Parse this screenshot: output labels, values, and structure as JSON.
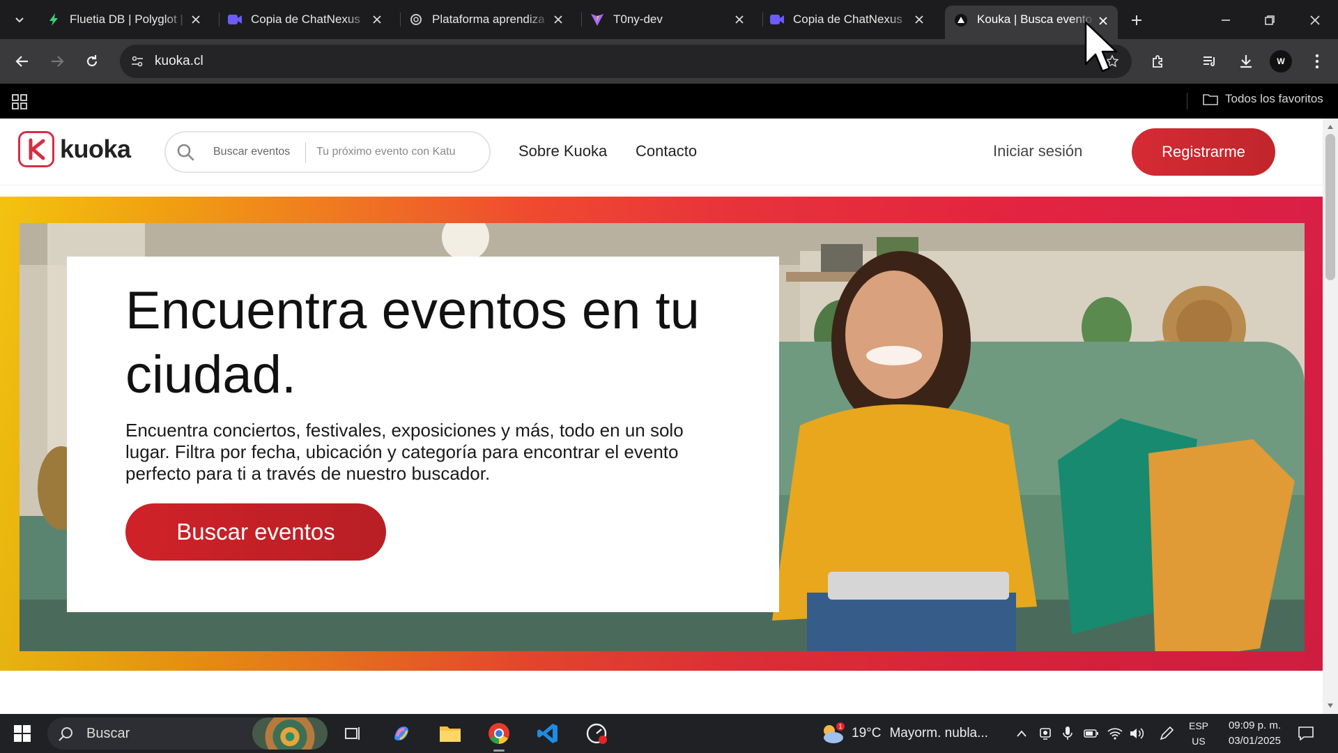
{
  "browser": {
    "tabs": [
      {
        "title": "Fluetia DB | Polyglot |",
        "icon": "bolt-icon",
        "active": false
      },
      {
        "title": "Copia de ChatNexus",
        "icon": "video-icon",
        "active": false
      },
      {
        "title": "Plataforma aprendiza",
        "icon": "openai-icon",
        "active": false
      },
      {
        "title": "T0ny-dev",
        "icon": "vite-icon",
        "active": false
      },
      {
        "title": "Copia de ChatNexus",
        "icon": "video-icon",
        "active": false
      },
      {
        "title": "Kouka | Busca evento",
        "icon": "kuoka-favicon",
        "active": true
      }
    ],
    "url": "kuoka.cl",
    "bookmarks_label": "Todos los favoritos",
    "profile_initial": "W"
  },
  "site": {
    "logo_text": "kuoka",
    "search": {
      "label": "Buscar eventos",
      "placeholder": "Tu próximo evento con Katu"
    },
    "nav": [
      {
        "label": "Sobre Kuoka"
      },
      {
        "label": "Contacto"
      }
    ],
    "login_label": "Iniciar sesión",
    "register_label": "Registrarme",
    "hero": {
      "title": "Encuentra eventos en tu ciudad.",
      "subtitle": "Encuentra conciertos, festivales, exposiciones y más, todo en un solo lugar. Filtra por fecha, ubicación y categoría para encontrar el evento perfecto para ti a través de nuestro buscador.",
      "button_label": "Buscar eventos"
    },
    "brand_color": "#d62a35"
  },
  "taskbar": {
    "search_label": "Buscar",
    "weather": {
      "temp": "19°C",
      "desc": "Mayorm. nubla...",
      "alert_count": "1"
    },
    "lang": {
      "line1": "ESP",
      "line2": "US"
    },
    "clock": {
      "time": "09:09 p. m.",
      "date": "03/01/2025"
    }
  }
}
